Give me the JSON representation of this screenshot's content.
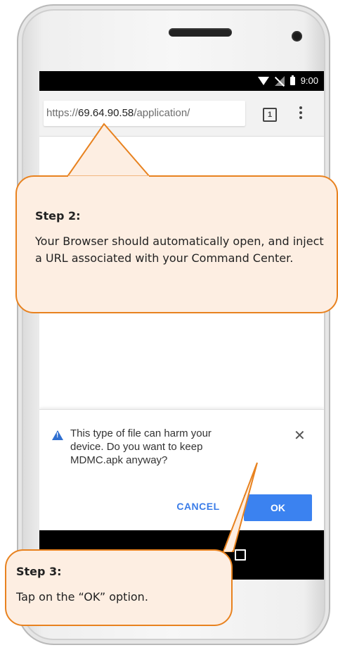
{
  "status_bar": {
    "time": "9:00",
    "icons": [
      "wifi-icon",
      "no-signal-icon",
      "battery-icon"
    ]
  },
  "browser": {
    "url_protocol": "https://",
    "url_host": "69.64.90.58",
    "url_path": "/application/",
    "tab_count": "1",
    "menu_icon": "more-vert-icon"
  },
  "download_prompt": {
    "message": "This type of file can harm your\ndevice. Do you want to keep\nMDMC.apk anyway?",
    "warning_icon": "warning-icon",
    "close_icon": "close-icon",
    "cancel_label": "CANCEL",
    "ok_label": "OK"
  },
  "nav_bar": {
    "recent_icon": "recent-apps-icon"
  },
  "callouts": {
    "step2": {
      "title": "Step 2:",
      "body": "Your Browser should automatically open, and inject a URL associated with your Command Center."
    },
    "step3": {
      "title": "Step 3:",
      "body": "Tap on the “OK” option."
    }
  },
  "colors": {
    "callout_fill": "#fdeee2",
    "callout_border": "#e8821f",
    "ok_button": "#3b82f0",
    "cancel_text": "#3b7de8"
  }
}
